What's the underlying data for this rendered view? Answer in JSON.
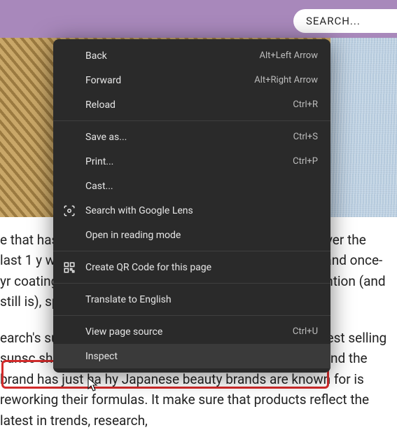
{
  "search": {
    "placeholder": "SEARCH..."
  },
  "contextMenu": {
    "items": [
      {
        "label": "Back",
        "shortcut": "Alt+Left Arrow"
      },
      {
        "label": "Forward",
        "shortcut": "Alt+Right Arrow"
      },
      {
        "label": "Reload",
        "shortcut": "Ctrl+R"
      },
      {
        "label": "Save as...",
        "shortcut": "Ctrl+S"
      },
      {
        "label": "Print...",
        "shortcut": "Ctrl+P"
      },
      {
        "label": "Cast..."
      },
      {
        "label": "Search with Google Lens",
        "icon": "lens"
      },
      {
        "label": "Open in reading mode"
      },
      {
        "label": "Create QR Code for this page",
        "icon": "qr"
      },
      {
        "label": "Translate to English"
      },
      {
        "label": "View page source",
        "shortcut": "Ctrl+U"
      },
      {
        "label": "Inspect"
      }
    ]
  },
  "article": {
    "p1": "e that has been gaining a reputation all over the world over the last 1 y were talking about multi-step skincare routines and once-yr coatings on s was the first to capture the world's attention (and still is), specifically n anese w",
    "p2": "earch's suggests that one of the country's newest and best selling sunsc ship product, was reformulated in the past year. And the brand has just ha hy Japanese beauty brands are known for is reworking their formulas. It make sure that products reflect the latest in trends, research,"
  }
}
